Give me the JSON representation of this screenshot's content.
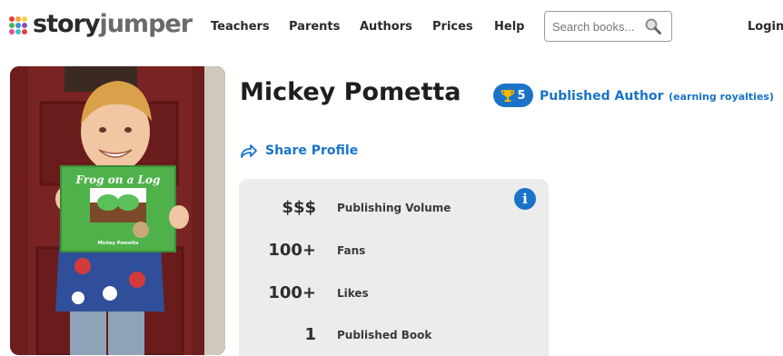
{
  "header": {
    "logo": {
      "part1": "story",
      "part2": "jumper"
    },
    "nav": [
      "Teachers",
      "Parents",
      "Authors",
      "Prices",
      "Help"
    ],
    "search_placeholder": "Search books...",
    "login_label": "Login"
  },
  "profile": {
    "name": "Mickey Pometta",
    "trophy_count": "5",
    "status_main": "Published Author",
    "status_sub": "(earning royalties)",
    "share_label": "Share Profile",
    "photo_book_title": "Frog on a Log",
    "photo_book_author": "Mickey Pometta"
  },
  "stats": [
    {
      "value": "$$$",
      "label": "Publishing Volume"
    },
    {
      "value": "100+",
      "label": "Fans"
    },
    {
      "value": "100+",
      "label": "Likes"
    },
    {
      "value": "1",
      "label": "Published Book"
    }
  ],
  "icons": {
    "search": "search-icon",
    "trophy": "trophy-icon",
    "share": "share-icon",
    "info": "info-icon"
  },
  "colors": {
    "brand_blue": "#1a73c9",
    "stats_bg": "#ececec"
  }
}
